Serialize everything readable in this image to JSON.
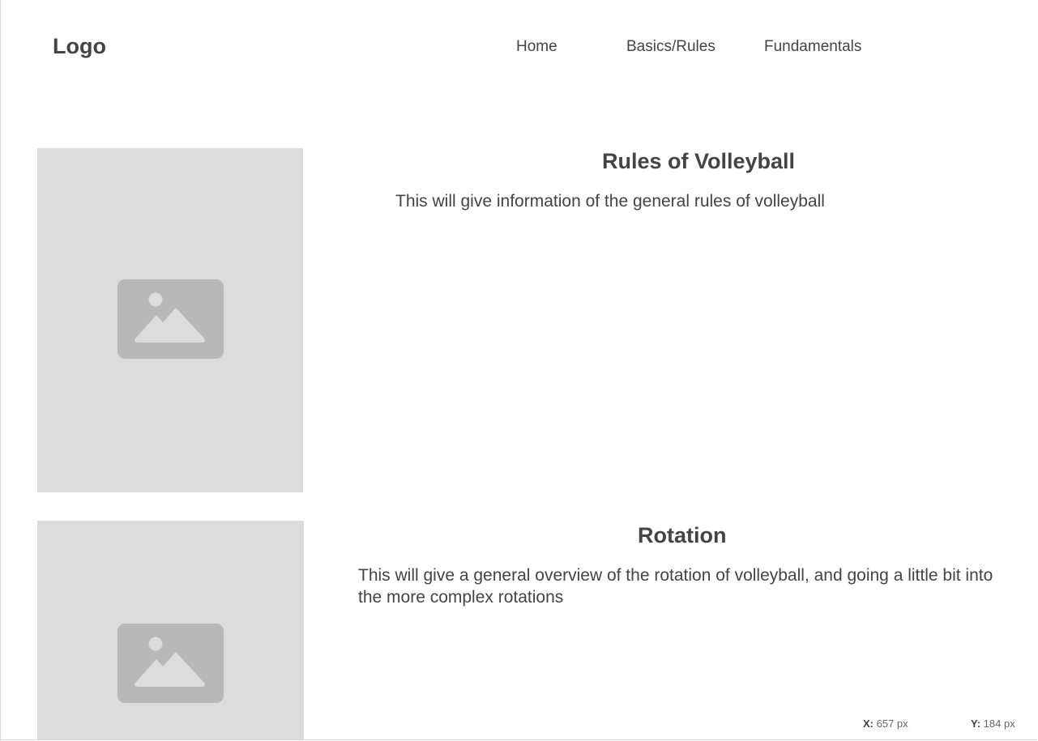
{
  "header": {
    "logo": "Logo",
    "nav": [
      {
        "label": "Home"
      },
      {
        "label": "Basics/Rules"
      },
      {
        "label": "Fundamentals"
      }
    ]
  },
  "sections": [
    {
      "title": "Rules of Volleyball",
      "text": "This will give information of the general rules of volleyball",
      "image_icon": "image-placeholder-icon"
    },
    {
      "title": "Rotation",
      "text": "This will give a general overview of the rotation of volleyball, and going a little bit into the more complex rotations",
      "image_icon": "image-placeholder-icon"
    }
  ],
  "status": {
    "x_label": "X:",
    "x_value": "657 px",
    "y_label": "Y:",
    "y_value": "184 px"
  },
  "colors": {
    "placeholder_bg": "#dcdcdc",
    "placeholder_icon": "#b8b8b8",
    "text": "#444444"
  }
}
